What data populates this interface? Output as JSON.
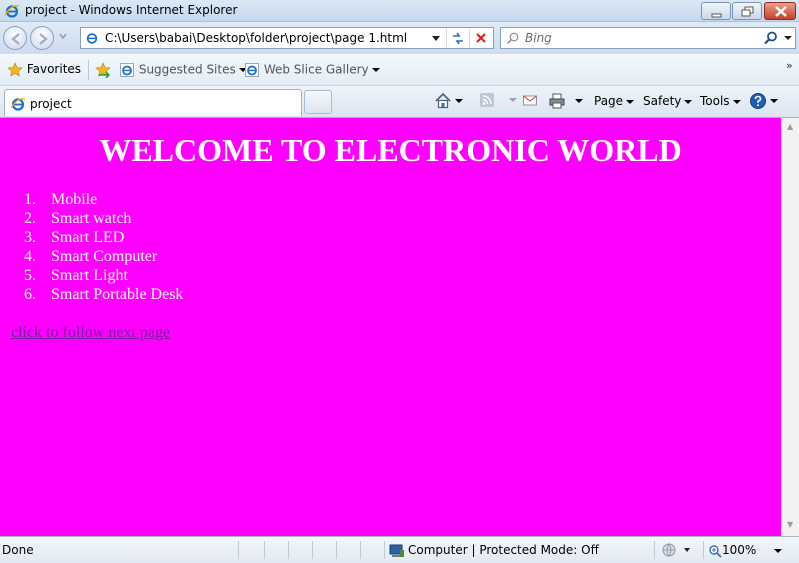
{
  "window": {
    "title": "project - Windows Internet Explorer"
  },
  "address_bar": {
    "url": "C:\\Users\\babai\\Desktop\\folder\\project\\page 1.html"
  },
  "search": {
    "placeholder": "Bing"
  },
  "favorites_bar": {
    "favorites_label": "Favorites",
    "suggested_sites_label": "Suggested Sites",
    "web_slice_gallery_label": "Web Slice Gallery"
  },
  "tab": {
    "label": "project"
  },
  "command_bar": {
    "page_label": "Page",
    "safety_label": "Safety",
    "tools_label": "Tools"
  },
  "page": {
    "background_color": "#ff00ff",
    "heading": "WELCOME TO ELECTRONIC WORLD",
    "items": [
      {
        "num": "1.",
        "label": "Mobile"
      },
      {
        "num": "2.",
        "label": "Smart watch"
      },
      {
        "num": "3.",
        "label": "Smart LED"
      },
      {
        "num": "4.",
        "label": "Smart Computer"
      },
      {
        "num": "5.",
        "label": "Smart Light"
      },
      {
        "num": "6.",
        "label": "Smart Portable Desk"
      }
    ],
    "link_text": "click to follow next page"
  },
  "status_bar": {
    "status": "Done",
    "zone": "Computer | Protected Mode: Off",
    "zoom": "100%"
  }
}
